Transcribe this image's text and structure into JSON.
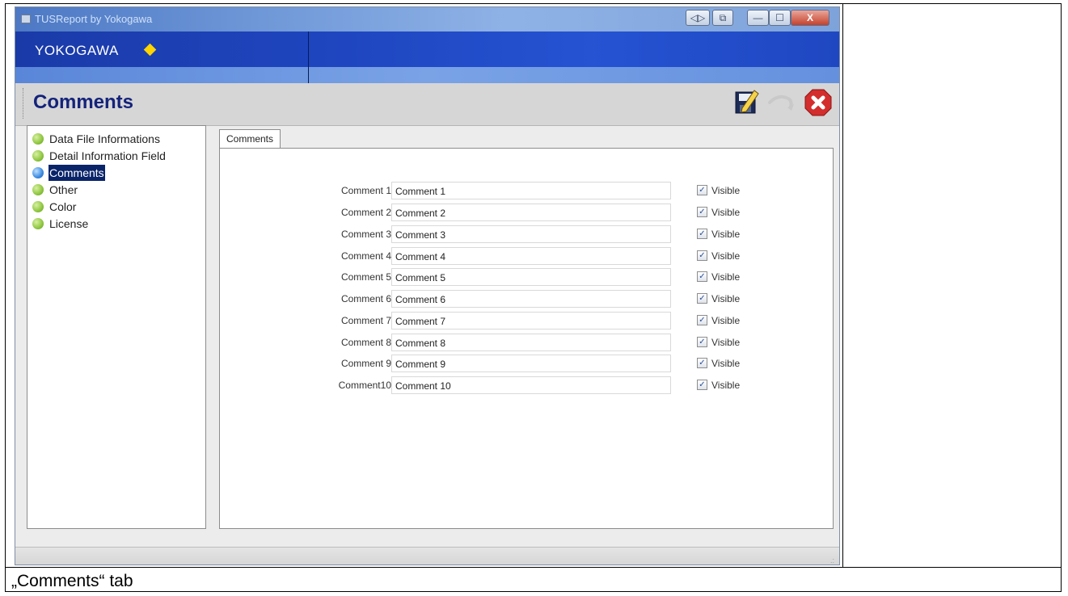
{
  "window": {
    "title": "TUSReport by Yokogawa"
  },
  "titlebar_buttons": {
    "nav": "◁▷",
    "snap": "⧉",
    "minimize": "—",
    "maximize": "☐",
    "close": "X"
  },
  "brand": {
    "logo_text": "YOKOGAWA",
    "logo_color": "#ffd400"
  },
  "page": {
    "title": "Comments"
  },
  "toolbar": {
    "save_icon": "save-edit-icon",
    "undo_icon": "undo-icon",
    "close_icon": "close-circle-icon"
  },
  "nav": {
    "items": [
      {
        "label": "Data File Informations"
      },
      {
        "label": "Detail Information Field"
      },
      {
        "label": "Comments",
        "selected": true
      },
      {
        "label": "Other"
      },
      {
        "label": "Color"
      },
      {
        "label": "License"
      }
    ]
  },
  "tab": {
    "label": "Comments"
  },
  "comments": [
    {
      "label": "Comment 1",
      "value": "Comment 1",
      "visible": true,
      "visible_label": "Visible"
    },
    {
      "label": "Comment 2",
      "value": "Comment 2",
      "visible": true,
      "visible_label": "Visible"
    },
    {
      "label": "Comment 3",
      "value": "Comment 3",
      "visible": true,
      "visible_label": "Visible"
    },
    {
      "label": "Comment 4",
      "value": "Comment 4",
      "visible": true,
      "visible_label": "Visible"
    },
    {
      "label": "Comment 5",
      "value": "Comment 5",
      "visible": true,
      "visible_label": "Visible"
    },
    {
      "label": "Comment 6",
      "value": "Comment 6",
      "visible": true,
      "visible_label": "Visible"
    },
    {
      "label": "Comment 7",
      "value": "Comment 7",
      "visible": true,
      "visible_label": "Visible"
    },
    {
      "label": "Comment 8",
      "value": "Comment 8",
      "visible": true,
      "visible_label": "Visible"
    },
    {
      "label": "Comment 9",
      "value": "Comment 9",
      "visible": true,
      "visible_label": "Visible"
    },
    {
      "label": "Comment10",
      "value": "Comment 10",
      "visible": true,
      "visible_label": "Visible"
    }
  ],
  "caption": "„Comments“ tab"
}
